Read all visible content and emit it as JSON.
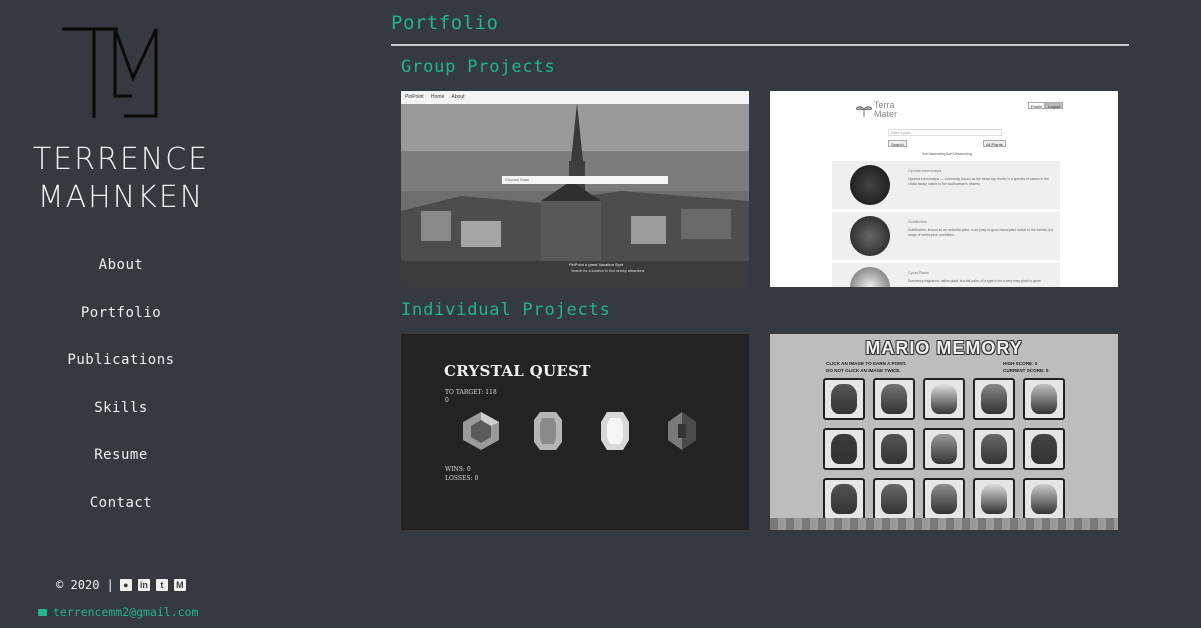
{
  "sidebar": {
    "logo_monogram": "TM",
    "name_line1": "TERRENCE",
    "name_line2": "MAHNKEN",
    "nav": [
      {
        "label": "About"
      },
      {
        "label": "Portfolio"
      },
      {
        "label": "Publications"
      },
      {
        "label": "Skills"
      },
      {
        "label": "Resume"
      },
      {
        "label": "Contact"
      }
    ],
    "copyright": "© 2020 |",
    "social_icons": [
      "github-icon",
      "linkedin-icon",
      "twitter-icon",
      "medium-icon"
    ],
    "email": "terrencemm2@gmail.com"
  },
  "main": {
    "title": "Portfolio",
    "group_title": "Group Projects",
    "individual_title": "Individual Projects",
    "cards": {
      "pinpoint": {
        "brand": "PinPoint",
        "nav_home": "Home",
        "nav_about": "About",
        "search_placeholder": "Choose State",
        "tagline": "PinPoint a great Vacation Spot",
        "subtag": "Search for a location to find nearby attractions"
      },
      "terra": {
        "brand_line1": "Terra",
        "brand_line2": "Mater",
        "btn_profile": "Profile",
        "btn_logout": "Logout",
        "input_placeholder": "Enter a plant",
        "btn_search": "Search",
        "btn_all": "All Plants",
        "link_1": "Sort Ascending",
        "link_2": "Sort Descending",
        "rows": [
          {
            "title": "Opuntia echinocarpa",
            "text": "Opuntia echinocarpa — commonly known as the straw-top cholla, is a species of cactus in the cholla family, native to the southwestern deserts."
          },
          {
            "title": "Goldfinches",
            "text": "Goldfinches, known as an umbrella plant, is an easy-to-grow houseplant native to the forests of a range of subtropical conditions."
          },
          {
            "title": "Cycas Plants",
            "text": "Dormancy fragrance, native plant, is a tall palm, of a type to be a very easy plant to grow."
          }
        ]
      },
      "crystal": {
        "title": "CRYSTAL QUEST",
        "target": "TO TARGET: 118",
        "score": "0",
        "wins": "WINS: 0",
        "losses": "LOSSES: 0"
      },
      "mario": {
        "title": "MARIO MEMORY",
        "instr_left_1": "CLICK AN IMAGE TO EARN A POINT.",
        "instr_left_2": "DO NOT CLICK AN IMAGE TWICE.",
        "instr_right_1": "HIGH SCORE: 0",
        "instr_right_2": "CURRENT SCORE: 0"
      }
    }
  },
  "colors": {
    "background": "#343a40",
    "accent": "#24b48c",
    "text": "#f0f0f0"
  }
}
